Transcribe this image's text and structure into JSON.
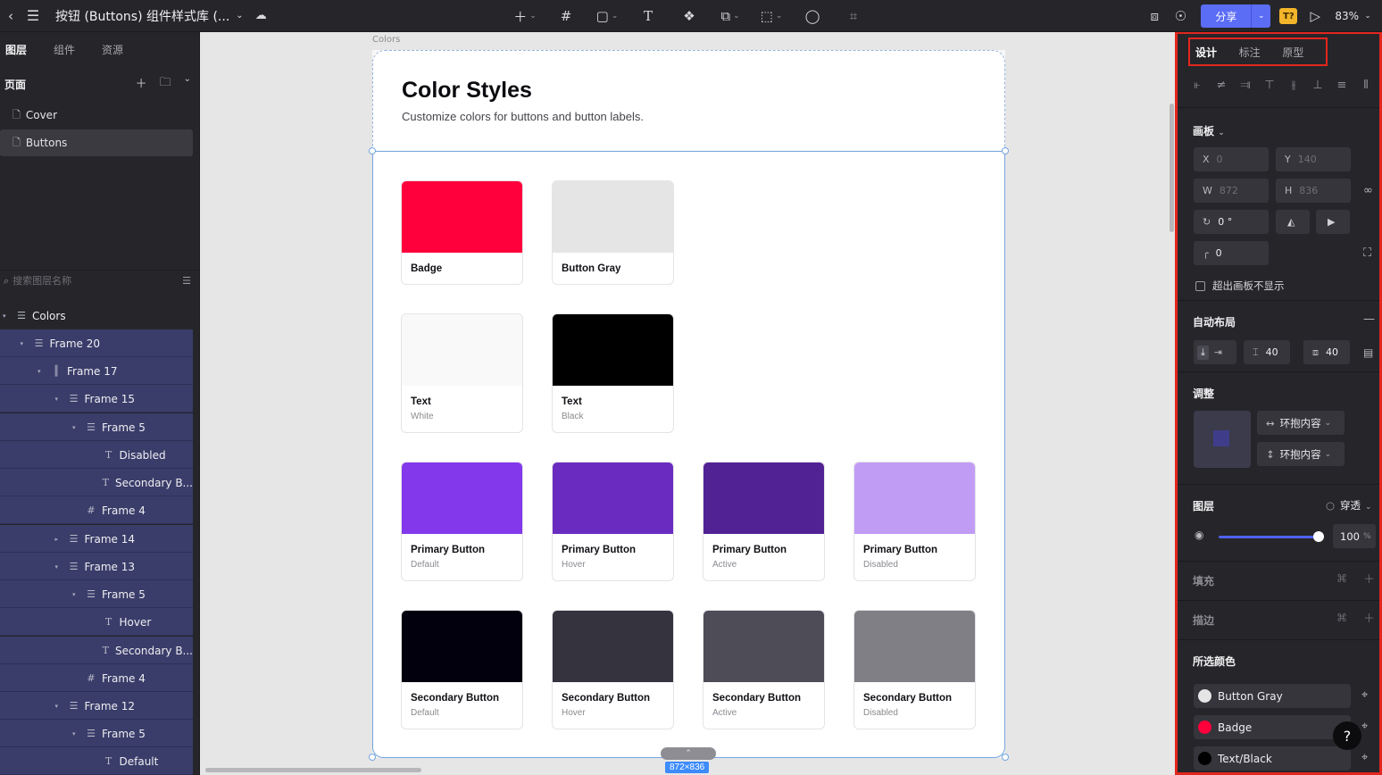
{
  "topbar": {
    "doc_title": "按钮 (Buttons) 组件样式库 (...",
    "share_label": "分享",
    "badge_label": "T?",
    "zoom": "83%"
  },
  "left": {
    "tabs": [
      "图层",
      "组件",
      "资源"
    ],
    "pages_title": "页面",
    "pages": [
      "Cover",
      "Buttons"
    ],
    "search_placeholder": "搜索图层名称",
    "layers": [
      {
        "name": "Colors"
      },
      {
        "name": "Frame 20"
      },
      {
        "name": "Frame 17"
      },
      {
        "name": "Frame 15"
      },
      {
        "name": "Frame 5"
      },
      {
        "name": "Disabled"
      },
      {
        "name": "Secondary B..."
      },
      {
        "name": "Frame 4"
      },
      {
        "name": "Frame 14"
      },
      {
        "name": "Frame 13"
      },
      {
        "name": "Frame 5"
      },
      {
        "name": "Hover"
      },
      {
        "name": "Secondary B..."
      },
      {
        "name": "Frame 4"
      },
      {
        "name": "Frame 12"
      },
      {
        "name": "Frame 5"
      },
      {
        "name": "Default"
      }
    ]
  },
  "canvas": {
    "frame_label": "Colors",
    "title": "Color Styles",
    "subtitle": "Customize colors for buttons and button labels.",
    "size_label": "872×836",
    "swatches": [
      {
        "name": "Badge",
        "sub": "",
        "color": "#ff003c"
      },
      {
        "name": "Button Gray",
        "sub": "",
        "color": "#e5e5e6"
      },
      {
        "name": "Text",
        "sub": "White",
        "color": "#f9f9fa"
      },
      {
        "name": "Text",
        "sub": "Black",
        "color": "#000000"
      },
      {
        "name": "Primary Button",
        "sub": "Default",
        "color": "#8338ec"
      },
      {
        "name": "Primary Button",
        "sub": "Hover",
        "color": "#6a2cc0"
      },
      {
        "name": "Primary Button",
        "sub": "Active",
        "color": "#512293"
      },
      {
        "name": "Primary Button",
        "sub": "Disabled",
        "color": "#c19cf5"
      },
      {
        "name": "Secondary Button",
        "sub": "Default",
        "color": "#03000e"
      },
      {
        "name": "Secondary Button",
        "sub": "Hover",
        "color": "#35333e"
      },
      {
        "name": "Secondary Button",
        "sub": "Active",
        "color": "#4e4c56"
      },
      {
        "name": "Secondary Button",
        "sub": "Disabled",
        "color": "#807f86"
      }
    ]
  },
  "right": {
    "tabs": [
      "设计",
      "标注",
      "原型"
    ],
    "artboard_label": "画板",
    "x_label": "X",
    "x_value": "0",
    "y_label": "Y",
    "y_value": "140",
    "w_label": "W",
    "w_value": "872",
    "h_label": "H",
    "h_value": "836",
    "rotation": "0 °",
    "radius": "0",
    "clip_label": "超出画板不显示",
    "auto_layout_title": "自动布局",
    "gap": "40",
    "padding": "40",
    "adjust_title": "调整",
    "hug_h": "环抱内容",
    "hug_v": "环抱内容",
    "layer_title": "图层",
    "blend_mode": "穿透",
    "opacity": "100",
    "opacity_unit": "%",
    "fill_title": "填充",
    "stroke_title": "描边",
    "selected_colors_title": "所选颜色",
    "selected_colors": [
      {
        "name": "Button Gray",
        "color": "#e5e5e6"
      },
      {
        "name": "Badge",
        "color": "#ff003c"
      },
      {
        "name": "Text/Black",
        "color": "#000000"
      }
    ],
    "help": "?"
  }
}
